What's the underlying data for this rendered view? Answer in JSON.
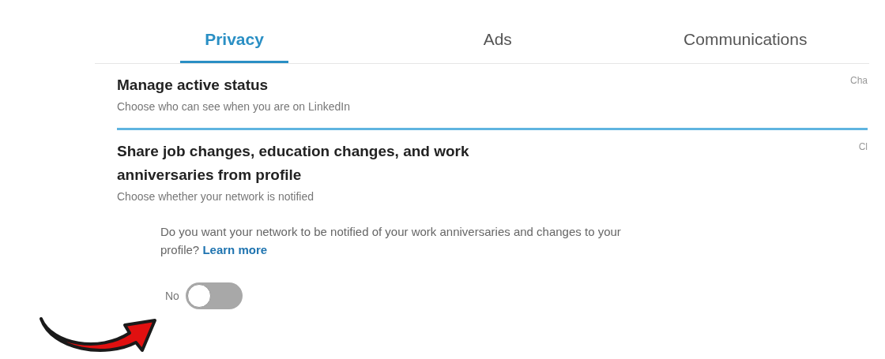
{
  "tabs": [
    {
      "label": "Privacy",
      "selected": true
    },
    {
      "label": "Ads",
      "selected": false
    },
    {
      "label": "Communications",
      "selected": false
    }
  ],
  "sections": [
    {
      "title": "Manage active status",
      "subtitle": "Choose who can see when you are on LinkedIn",
      "action": "Cha",
      "expanded": false
    },
    {
      "title": "Share job changes, education changes, and work anniversaries from profile",
      "subtitle": "Choose whether your network is notified",
      "action": "Cl",
      "expanded": true,
      "question": "Do you want your network to be notified of your work anniversaries and changes to your profile?",
      "link": "Learn more",
      "toggle": {
        "label": "No",
        "on": false
      }
    }
  ]
}
